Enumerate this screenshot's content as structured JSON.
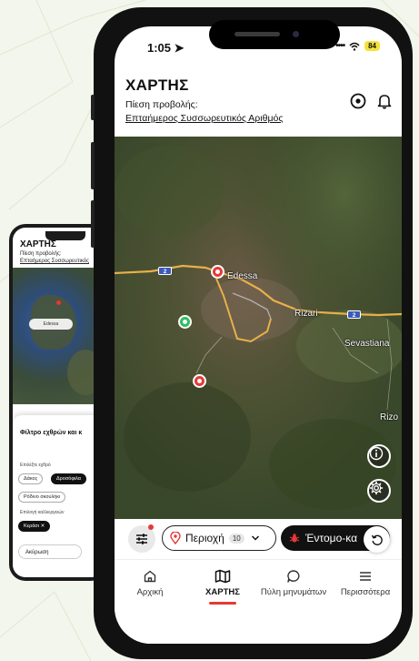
{
  "status": {
    "time": "1:05",
    "battery": "84"
  },
  "header": {
    "title": "ΧΑΡΤΗΣ",
    "pressure_label": "Πίεση προβολής:",
    "pressure_link": "Επταήμερος Συσσωρευτικός Αριθμός"
  },
  "map": {
    "places": [
      "Edessa",
      "Rizari",
      "Sevastiana",
      "Rizo"
    ],
    "road_numbers": [
      "2",
      "2"
    ],
    "colors": {
      "pin_red": "#e53935",
      "pin_green": "#2fbf5f",
      "road": "#e8b04a"
    }
  },
  "filters": {
    "region_label": "Περιοχή",
    "region_count": "10",
    "insect_label": "Έντομο-κα"
  },
  "nav": [
    {
      "label": "Αρχική",
      "icon": "home-icon"
    },
    {
      "label": "ΧΑΡΤΗΣ",
      "icon": "map-icon",
      "active": true
    },
    {
      "label": "Πύλη μηνυμάτων",
      "icon": "message-icon"
    },
    {
      "label": "Περισσότερα",
      "icon": "menu-icon"
    }
  ],
  "back_phone": {
    "title": "ΧΑΡΤΗΣ",
    "pressure_label": "Πίεση προβολής:",
    "pressure_link": "Επταήμερος Συσσωρευτικός",
    "map_pill": "Edessa",
    "sheet_title": "Φίλτρο εχθρών και κ",
    "select_enemy": "Επιλέξτε εχθρό",
    "chips": [
      "Δάκος",
      "Δροσόφιλα",
      "Ρόδινο σκουλήκι"
    ],
    "crop_label": "Επιλογή καλλιεργειών",
    "crop_chip": "Κεράσι",
    "cancel": "Ακύρωση"
  }
}
